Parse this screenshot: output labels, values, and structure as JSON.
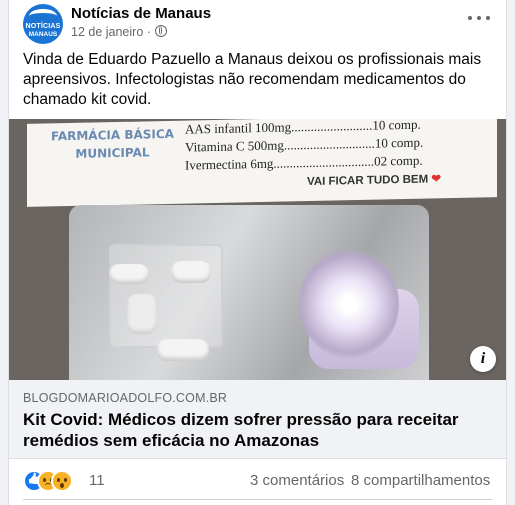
{
  "post": {
    "page_name": "Notícias de Manaus",
    "date": "12 de janeiro",
    "date_separator": "·",
    "text": "Vinda de Eduardo Pazuello a Manaus deixou os profissionais mais apreensivos. Infectologistas não recomendam medicamentos do chamado kit covid.",
    "avatar": {
      "brand_top": "NOTÍCIAS",
      "brand_bottom": "MANAUS",
      "color": "#1b74d4"
    }
  },
  "image": {
    "pharmacy_label_line1": "FARMÁCIA BÁSICA",
    "pharmacy_label_line2": "MUNICIPAL",
    "med_lines": [
      "AAS infantil 100mg.........................10 comp.",
      "Vitamina C 500mg............................10 comp.",
      "Ivermectina 6mg...............................02 comp."
    ],
    "note": "VAI FICAR TUDO BEM",
    "note_heart": "❤"
  },
  "link": {
    "domain": "BLOGDOMARIOADOLFO.COM.BR",
    "headline": "Kit Covid: Médicos dizem sofrer pressão para receitar remédios sem eficácia no Amazonas"
  },
  "stats": {
    "reaction_count": "11",
    "comments": "3 comentários",
    "shares": "8 compartilhamentos",
    "reaction_icons": [
      "like-icon",
      "sad-icon",
      "wow-icon"
    ]
  },
  "colors": {
    "secondary_text": "#65676b",
    "primary_text": "#050505",
    "like_blue": "#1877f2",
    "link_box_bg": "#f0f2f5"
  }
}
